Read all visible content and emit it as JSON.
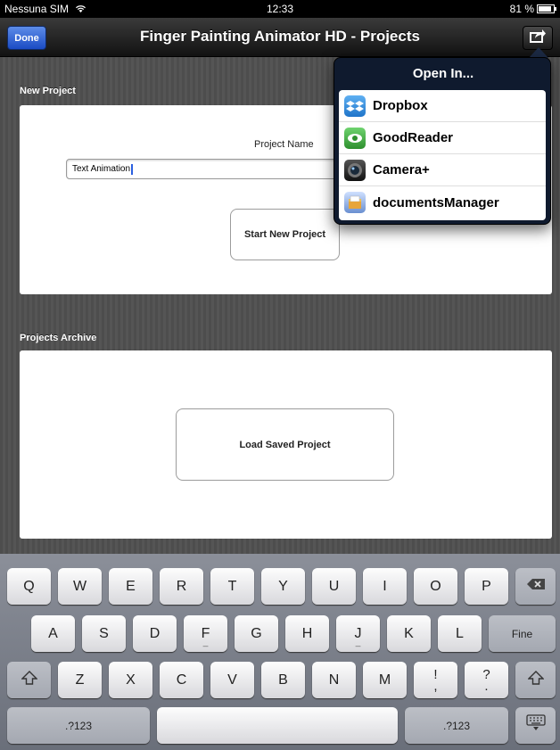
{
  "status_bar": {
    "carrier": "Nessuna SIM",
    "time": "12:33",
    "battery": "81 %"
  },
  "nav": {
    "done_label": "Done",
    "title": "Finger Painting Animator HD - Projects",
    "action_icon": "share-icon"
  },
  "new_project": {
    "section_label": "New Project",
    "field_label": "Project Name",
    "input_value": "Text Animation",
    "start_button": "Start New Project"
  },
  "archive": {
    "section_label": "Projects Archive",
    "load_button": "Load Saved Project"
  },
  "popover": {
    "title": "Open In...",
    "items": [
      {
        "label": "Dropbox",
        "icon": "dropbox-icon",
        "color": "#2f8ee0"
      },
      {
        "label": "GoodReader",
        "icon": "goodreader-icon",
        "color": "#3aa63a"
      },
      {
        "label": "Camera+",
        "icon": "camera-plus-icon",
        "color": "#333333"
      },
      {
        "label": "documentsManager",
        "icon": "documents-manager-icon",
        "color": "#6a8fd0"
      }
    ]
  },
  "keyboard": {
    "row1": [
      "Q",
      "W",
      "E",
      "R",
      "T",
      "Y",
      "U",
      "I",
      "O",
      "P"
    ],
    "row2": [
      "A",
      "S",
      "D",
      "F",
      "G",
      "H",
      "J",
      "K",
      "L"
    ],
    "return_label": "Fine",
    "row3": [
      "Z",
      "X",
      "C",
      "V",
      "B",
      "N",
      "M"
    ],
    "punct1_top": "!",
    "punct1_bottom": ",",
    "punct2_top": "?",
    "punct2_bottom": ".",
    "numbers_label": ".?123",
    "hide_icon": "keyboard-hide-icon",
    "shift_icon": "shift-icon",
    "backspace_icon": "backspace-icon"
  }
}
